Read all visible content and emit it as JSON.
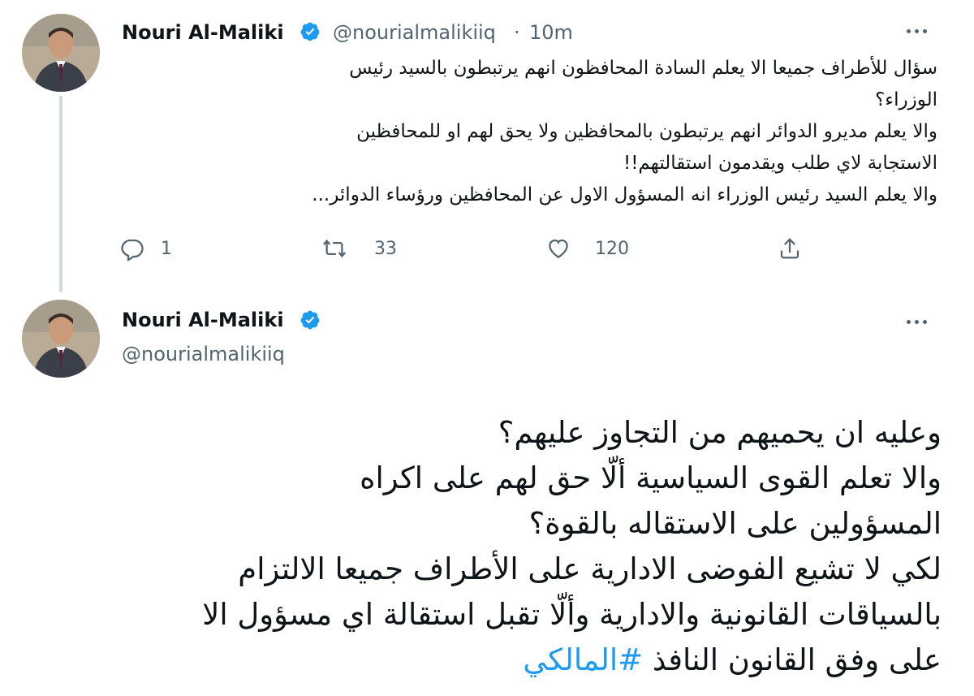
{
  "tweet1": {
    "author_name": "Nouri Al-Maliki",
    "handle": "@nourialmalikiiq",
    "separator": "·",
    "time": "10m",
    "text_lines": [
      "سؤال للأطراف جميعا الا يعلم السادة المحافظون انهم يرتبطون بالسيد رئيس",
      "الوزراء؟",
      "والا يعلم مديرو الدوائر انهم يرتبطون بالمحافظين ولا يحق لهم او للمحافظين",
      "الاستجابة لاي طلب ويقدمون استقالتهم!!",
      "والا يعلم السيد رئيس الوزراء انه المسؤول الاول عن المحافظين ورؤساء الدوائر..."
    ],
    "actions": {
      "reply_count": "1",
      "retweet_count": "33",
      "like_count": "120"
    }
  },
  "tweet2": {
    "author_name": "Nouri Al-Maliki",
    "handle": "@nourialmalikiiq",
    "text_lines": [
      "وعليه ان يحميهم من التجاوز عليهم؟",
      "والا تعلم القوى السياسية ألّا حق لهم على اكراه",
      "المسؤولين على الاستقاله بالقوة؟",
      "لكي لا تشيع الفوضى الادارية على الأطراف جميعا الالتزام",
      "بالسياقات القانونية والادارية وألّا تقبل استقالة اي مسؤول الا"
    ],
    "last_line_text": "على وفق القانون النافذ",
    "hashtag": "#المالكي"
  },
  "colors": {
    "accent": "#1d9bf0",
    "secondary_text": "#536471",
    "primary_text": "#0f1419",
    "thread_line": "#cfd9de"
  },
  "icons": [
    "verified-badge-icon",
    "more-options-icon",
    "reply-icon",
    "retweet-icon",
    "like-icon",
    "share-icon"
  ]
}
